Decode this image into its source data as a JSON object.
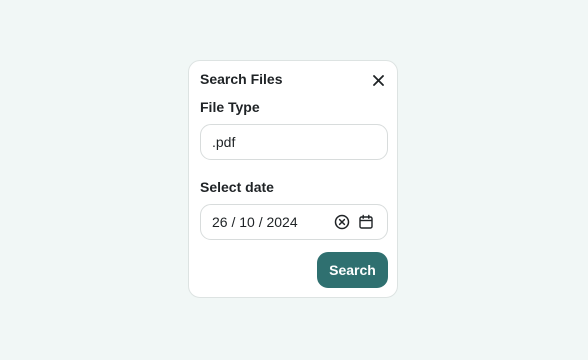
{
  "dialog": {
    "title": "Search Files",
    "close_icon": "close-icon"
  },
  "file_type": {
    "label": "File Type",
    "value": ".pdf"
  },
  "date": {
    "label": "Select date",
    "value": "26 / 10 / 2024",
    "clear_icon": "clear-circle-icon",
    "calendar_icon": "calendar-icon"
  },
  "actions": {
    "search_label": "Search"
  },
  "colors": {
    "background": "#f1f7f6",
    "accent": "#2f7070",
    "text": "#1f2326",
    "border": "#d8dcdc"
  }
}
